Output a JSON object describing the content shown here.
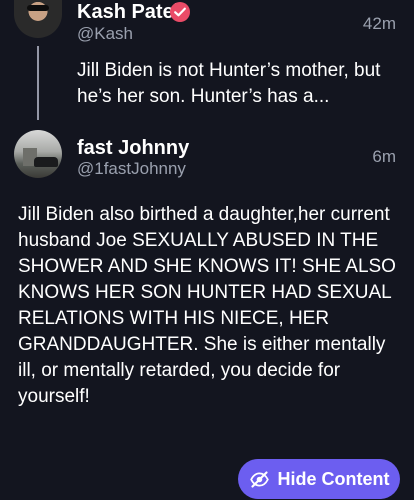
{
  "posts": [
    {
      "name": "Kash Patel",
      "handle": "@Kash",
      "time": "42m",
      "verified": true,
      "text": "Jill Biden is not Hunter’s mother, but he’s her son. Hunter’s has a..."
    },
    {
      "name": "fast Johnny",
      "handle": "@1fastJohnny",
      "time": "6m",
      "verified": false,
      "text": "Jill Biden also birthed a daughter,her current husband Joe SEXUALLY ABUSED IN THE SHOWER AND SHE KNOWS IT! SHE ALSO KNOWS HER SON HUNTER HAD SEXUAL RELATIONS WITH HIS NIECE, HER GRANDDAUGHTER. She is either mentally ill, or mentally retarded, you decide for yourself!"
    }
  ],
  "actions": {
    "hide_content_label": "Hide Content"
  },
  "icons": {
    "verified": "verified-badge-icon",
    "hide": "eye-slash-icon"
  },
  "colors": {
    "background": "#13151f",
    "secondary_text": "#9aa0ae",
    "verified": "#ea4b67",
    "button": "#6c5ef0"
  }
}
